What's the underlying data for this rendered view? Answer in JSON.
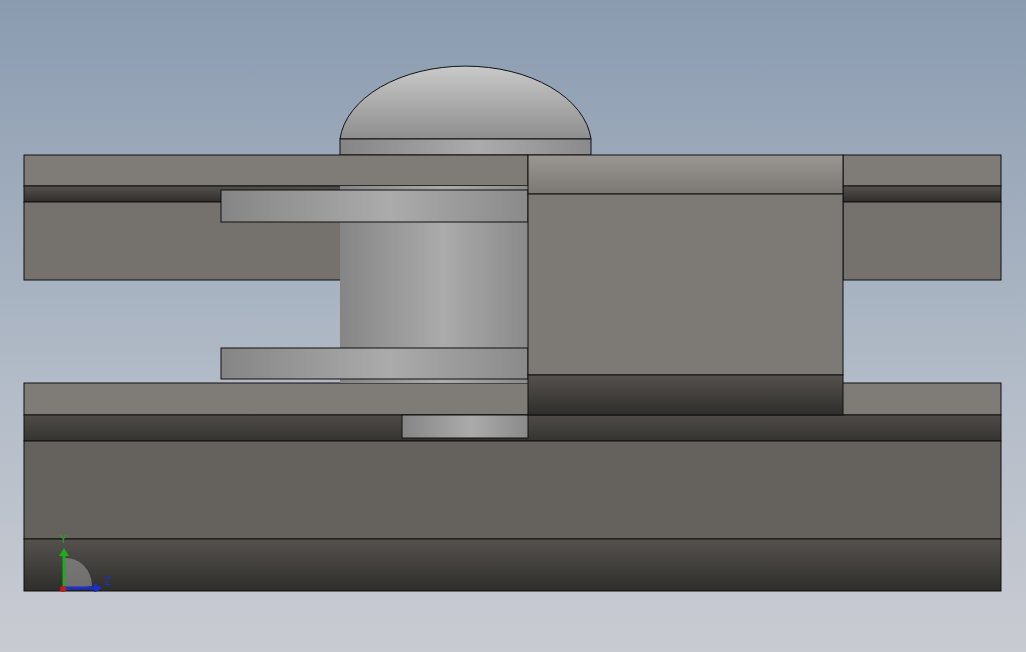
{
  "viewport": {
    "triad": {
      "y_label": "Y",
      "z_label": "Z"
    }
  }
}
